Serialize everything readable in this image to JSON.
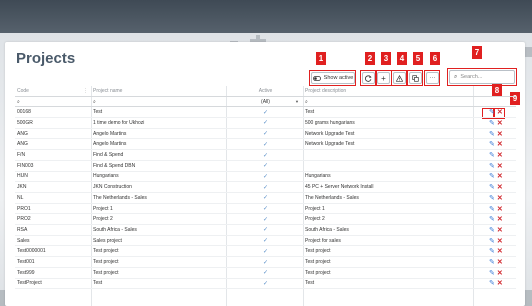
{
  "page": {
    "title": "Projects"
  },
  "toolbar": {
    "show_active_label": "Show active",
    "add_label": "+",
    "more_label": "···",
    "search_placeholder": "Search..."
  },
  "annotations": [
    "1",
    "2",
    "3",
    "4",
    "5",
    "6",
    "7",
    "8",
    "9"
  ],
  "grid": {
    "columns": [
      "Code",
      "Project name",
      "Active",
      "Project description"
    ],
    "active_filter": "(All)",
    "rows": [
      {
        "code": "00168",
        "name": "Test",
        "active": true,
        "desc": "Test"
      },
      {
        "code": "500GR",
        "name": "1 time demo for Ukhozi",
        "active": true,
        "desc": "500 grams hungarians"
      },
      {
        "code": "ANG",
        "name": "Angelo Martins",
        "active": true,
        "desc": "Network Upgrade Test"
      },
      {
        "code": "ANG",
        "name": "Angelo Martins",
        "active": true,
        "desc": "Network Upgrade Test"
      },
      {
        "code": "F/N",
        "name": "Find & Spend",
        "active": true,
        "desc": ""
      },
      {
        "code": "FIN003",
        "name": "Find & Spend DBN",
        "active": true,
        "desc": ""
      },
      {
        "code": "HUN",
        "name": "Hungarians",
        "active": true,
        "desc": "Hungarians"
      },
      {
        "code": "JKN",
        "name": "JKN Construction",
        "active": true,
        "desc": "45 PC + Server Network Install"
      },
      {
        "code": "NL",
        "name": "The Netherlands - Sales",
        "active": true,
        "desc": "The Netherlands - Sales"
      },
      {
        "code": "PRO1",
        "name": "Project 1",
        "active": true,
        "desc": "Project 1"
      },
      {
        "code": "PRO2",
        "name": "Project 2",
        "active": true,
        "desc": "Project 2"
      },
      {
        "code": "RSA",
        "name": "South Africa - Sales",
        "active": true,
        "desc": "South Africa - Sales"
      },
      {
        "code": "Sales",
        "name": "Sales project",
        "active": true,
        "desc": "Project for sales"
      },
      {
        "code": "Test0000001",
        "name": "Test project",
        "active": true,
        "desc": "Test project"
      },
      {
        "code": "Test001",
        "name": "Test project",
        "active": true,
        "desc": "Test project"
      },
      {
        "code": "Test999",
        "name": "Test project",
        "active": true,
        "desc": "Test project"
      },
      {
        "code": "TestProject",
        "name": "Test",
        "active": true,
        "desc": "Test"
      }
    ]
  },
  "colors": {
    "accent": "#3a7bd5",
    "annotation": "#e02020",
    "delete": "#d0232a"
  },
  "icons": {
    "show_active": "toggle-icon",
    "refresh": "refresh-icon",
    "add": "plus-icon",
    "warning": "warning-icon",
    "copy": "copy-icon",
    "more": "more-icon",
    "search": "search-icon",
    "edit": "pencil-icon",
    "delete": "close-icon",
    "sort": "sort-icon"
  }
}
